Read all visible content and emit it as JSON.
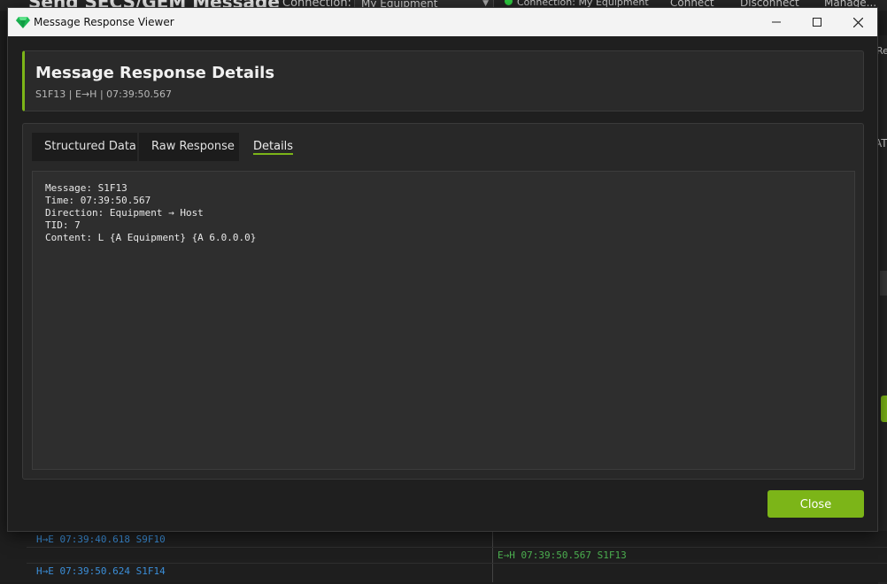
{
  "background": {
    "title": "Send SECS/GEM Message",
    "connection_label": "Connection:",
    "connection_value": "My Equipment",
    "status_text": "Connection: My Equipment",
    "buttons": [
      "Connect",
      "Disconnect",
      "Manage..."
    ],
    "right_fragments": [
      "Re",
      "AT"
    ],
    "log": {
      "left": [
        "H→E 07:39:40.618 S9F10",
        "H→E 07:39:50.624 S1F14"
      ],
      "right": [
        "E→H 07:39:50.567 S1F13"
      ]
    }
  },
  "window": {
    "title": "Message Response Viewer"
  },
  "header": {
    "title": "Message Response Details",
    "subtitle": "S1F13 | E→H | 07:39:50.567"
  },
  "tabs": [
    {
      "label": "Structured Data",
      "active": false
    },
    {
      "label": "Raw Response",
      "active": false
    },
    {
      "label": "Details",
      "active": true
    }
  ],
  "details": {
    "lines": [
      "Message: S1F13",
      "Time: 07:39:50.567",
      "Direction: Equipment → Host",
      "TID: 7",
      "Content: L {A Equipment} {A 6.0.0.0}"
    ]
  },
  "footer": {
    "close_label": "Close"
  },
  "colors": {
    "accent": "#7cb518",
    "log_host_to_equipment": "#3b8ed8",
    "log_equipment_to_host": "#4caf50"
  },
  "icons": [
    "app-gem-icon",
    "minimize-icon",
    "maximize-icon",
    "close-icon",
    "dropdown-arrow-icon",
    "status-dot-icon"
  ]
}
